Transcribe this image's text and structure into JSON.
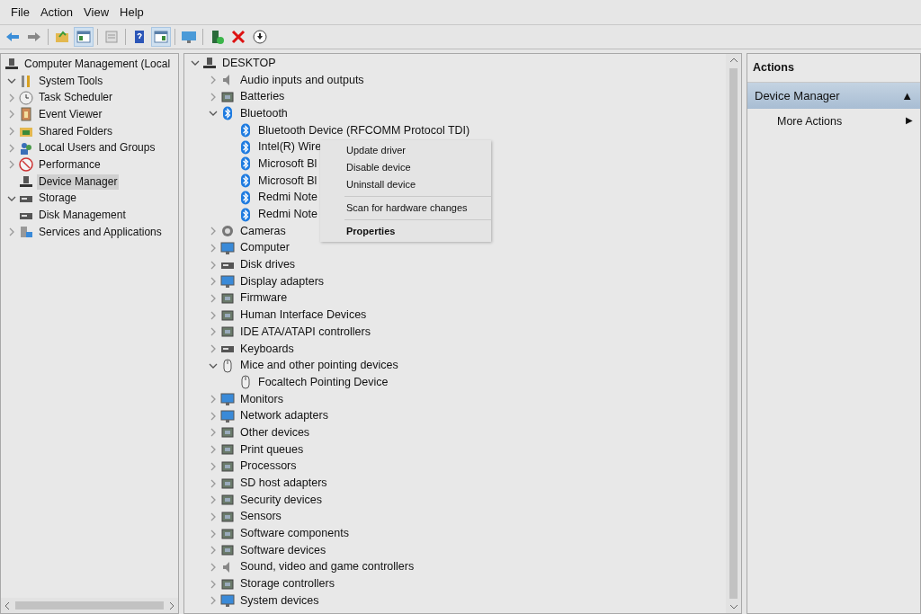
{
  "menu_bar": [
    "File",
    "Action",
    "View",
    "Help"
  ],
  "toolbar": [
    {
      "kind": "back",
      "pressed": false
    },
    {
      "kind": "forward",
      "pressed": false
    },
    {
      "kind": "up",
      "pressed": false
    },
    {
      "kind": "tree",
      "pressed": true
    },
    {
      "kind": "export",
      "pressed": false
    },
    {
      "kind": "help",
      "pressed": false
    },
    {
      "kind": "pane",
      "pressed": true
    },
    {
      "kind": "monitor",
      "pressed": false
    },
    {
      "kind": "driver",
      "pressed": false
    },
    {
      "kind": "remove",
      "pressed": false
    },
    {
      "kind": "download",
      "pressed": false
    }
  ],
  "console_tree": [
    {
      "label": "Computer Management (Local",
      "kind": "computer",
      "selected": false,
      "children": [
        {
          "label": "System Tools",
          "kind": "tools",
          "expanded": true,
          "selected": false,
          "children": [
            {
              "label": "Task Scheduler",
              "kind": "clock",
              "expanded": false,
              "selected": false
            },
            {
              "label": "Event Viewer",
              "kind": "log",
              "expanded": false,
              "selected": false
            },
            {
              "label": "Shared Folders",
              "kind": "folder",
              "expanded": false,
              "selected": false
            },
            {
              "label": "Local Users and Groups",
              "kind": "users",
              "expanded": false,
              "selected": false
            },
            {
              "label": "Performance",
              "kind": "gauge",
              "expanded": false,
              "selected": false
            },
            {
              "label": "Device Manager",
              "kind": "computer",
              "selected": true
            }
          ]
        },
        {
          "label": "Storage",
          "kind": "disk",
          "expanded": true,
          "selected": false,
          "children": [
            {
              "label": "Disk Management",
              "kind": "disk",
              "selected": false
            }
          ]
        },
        {
          "label": "Services and Applications",
          "kind": "services",
          "expanded": false,
          "selected": false
        }
      ]
    }
  ],
  "device_tree": [
    {
      "label": "DESKTOP",
      "kind": "computer",
      "expanded": true,
      "children": [
        {
          "label": "Audio inputs and outputs",
          "kind": "speaker",
          "expanded": false
        },
        {
          "label": "Batteries",
          "kind": "device",
          "expanded": false
        },
        {
          "label": "Bluetooth",
          "kind": "bluetooth",
          "expanded": true,
          "children": [
            {
              "label": "Bluetooth Device (RFCOMM Protocol TDI)",
              "kind": "bluetooth"
            },
            {
              "label": "Intel(R) Wire",
              "kind": "bluetooth"
            },
            {
              "label": "Microsoft Bl",
              "kind": "bluetooth"
            },
            {
              "label": "Microsoft Bl",
              "kind": "bluetooth"
            },
            {
              "label": "Redmi Note",
              "kind": "bluetooth"
            },
            {
              "label": "Redmi Note",
              "kind": "bluetooth"
            }
          ]
        },
        {
          "label": "Cameras",
          "kind": "camera",
          "expanded": false
        },
        {
          "label": "Computer",
          "kind": "monitor",
          "expanded": false
        },
        {
          "label": "Disk drives",
          "kind": "disk",
          "expanded": false
        },
        {
          "label": "Display adapters",
          "kind": "monitor",
          "expanded": false
        },
        {
          "label": "Firmware",
          "kind": "device",
          "expanded": false
        },
        {
          "label": "Human Interface Devices",
          "kind": "device",
          "expanded": false
        },
        {
          "label": "IDE ATA/ATAPI controllers",
          "kind": "device",
          "expanded": false
        },
        {
          "label": "Keyboards",
          "kind": "disk",
          "expanded": false
        },
        {
          "label": "Mice and other pointing devices",
          "kind": "mouse",
          "expanded": true,
          "children": [
            {
              "label": "Focaltech Pointing Device",
              "kind": "mouse"
            }
          ]
        },
        {
          "label": "Monitors",
          "kind": "monitor",
          "expanded": false
        },
        {
          "label": "Network adapters",
          "kind": "monitor",
          "expanded": false
        },
        {
          "label": "Other devices",
          "kind": "device",
          "expanded": false
        },
        {
          "label": "Print queues",
          "kind": "device",
          "expanded": false
        },
        {
          "label": "Processors",
          "kind": "device",
          "expanded": false
        },
        {
          "label": "SD host adapters",
          "kind": "device",
          "expanded": false
        },
        {
          "label": "Security devices",
          "kind": "device",
          "expanded": false
        },
        {
          "label": "Sensors",
          "kind": "device",
          "expanded": false
        },
        {
          "label": "Software components",
          "kind": "device",
          "expanded": false
        },
        {
          "label": "Software devices",
          "kind": "device",
          "expanded": false
        },
        {
          "label": "Sound, video and game controllers",
          "kind": "speaker",
          "expanded": false
        },
        {
          "label": "Storage controllers",
          "kind": "device",
          "expanded": false
        },
        {
          "label": "System devices",
          "kind": "monitor",
          "expanded": false
        }
      ]
    }
  ],
  "context_menu": [
    {
      "kind": "item",
      "label": "Update driver",
      "default": false
    },
    {
      "kind": "item",
      "label": "Disable device",
      "default": false
    },
    {
      "kind": "item",
      "label": "Uninstall device",
      "default": false
    },
    {
      "kind": "separator"
    },
    {
      "kind": "item",
      "label": "Scan for hardware changes",
      "default": false
    },
    {
      "kind": "separator"
    },
    {
      "kind": "item",
      "label": "Properties",
      "default": true
    }
  ],
  "actions": {
    "title": "Actions",
    "section": {
      "label": "Device Manager",
      "arrow": "▲"
    },
    "items": [
      {
        "label": "More Actions",
        "arrow": "▶"
      }
    ]
  }
}
